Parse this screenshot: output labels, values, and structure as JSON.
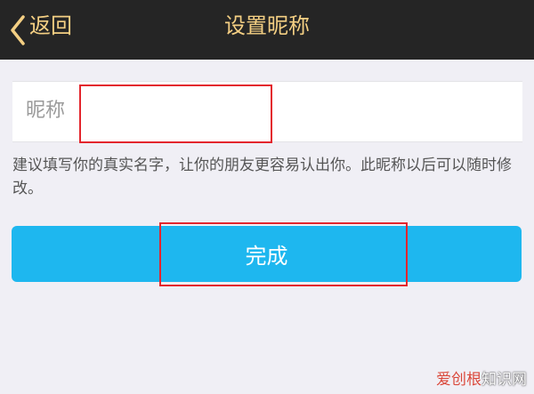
{
  "header": {
    "back_label": "返回",
    "title": "设置昵称",
    "back_icon": "chevron-left-icon"
  },
  "form": {
    "nickname_label": "昵称",
    "nickname_value": "",
    "hint": "建议填写你的真实名字，让你的朋友更容易认出你。此昵称以后可以随时修改。"
  },
  "actions": {
    "done_label": "完成"
  },
  "watermark": {
    "accent_text": "爱创根",
    "rest_text": "知识网"
  },
  "colors": {
    "header_bg": "#252525",
    "header_text": "#f4cf83",
    "button_bg": "#1eb7ef",
    "highlight": "#e3262d",
    "page_bg": "#f0eff5"
  }
}
